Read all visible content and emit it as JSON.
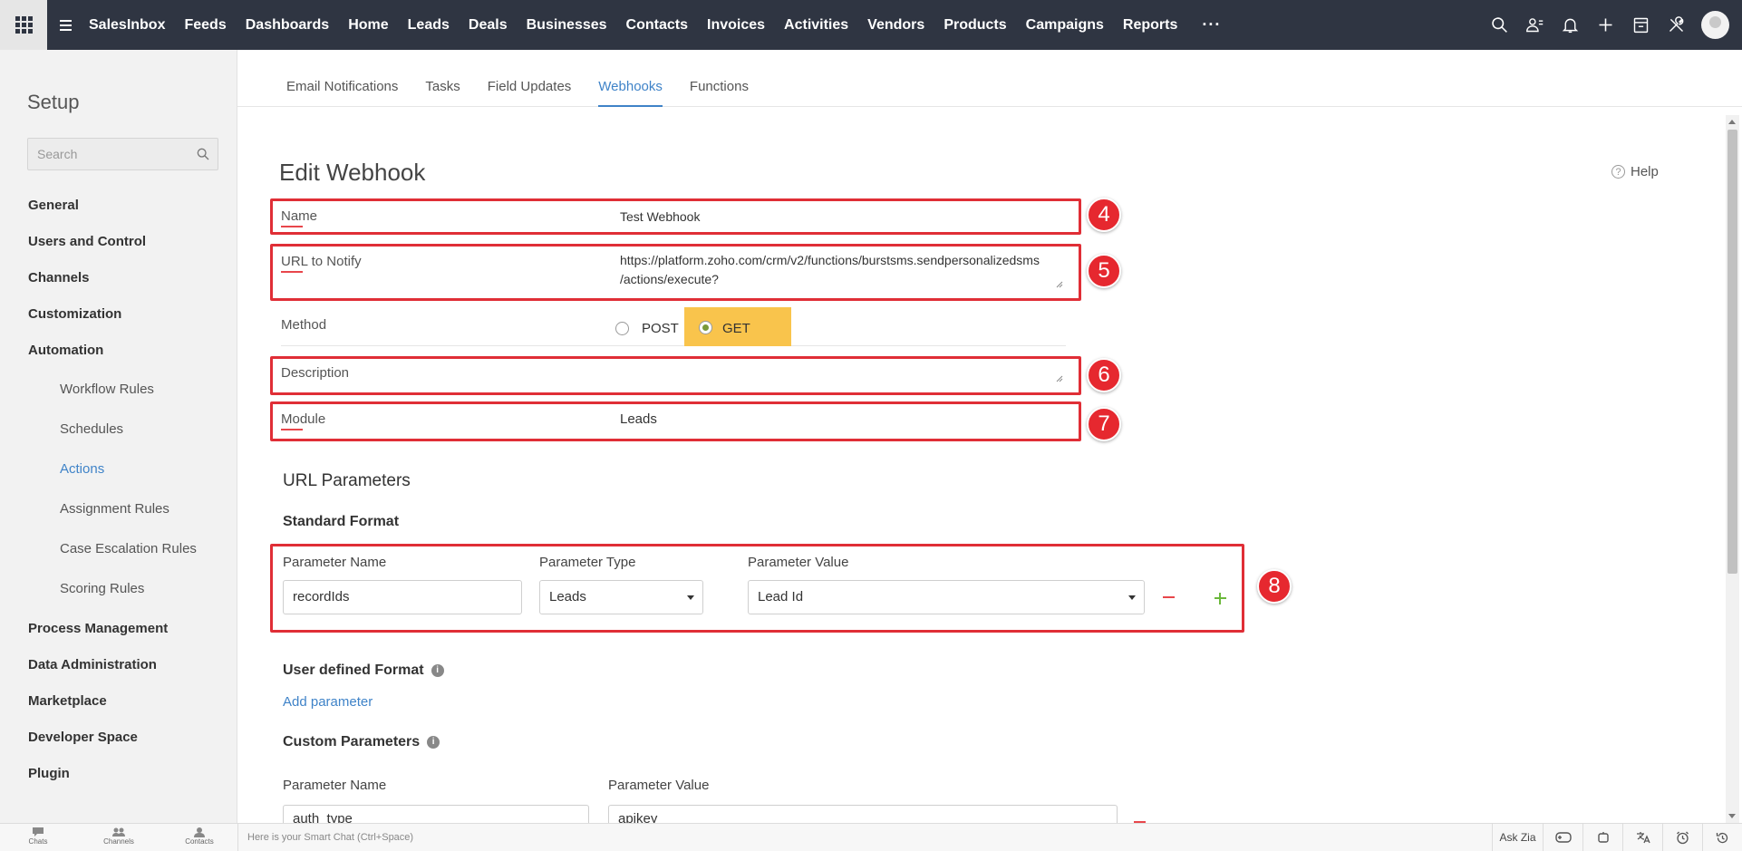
{
  "topbar": {
    "nav": [
      "SalesInbox",
      "Feeds",
      "Dashboards",
      "Home",
      "Leads",
      "Deals",
      "Businesses",
      "Contacts",
      "Invoices",
      "Activities",
      "Vendors",
      "Products",
      "Campaigns",
      "Reports"
    ],
    "more": "···",
    "icons": [
      "search-icon",
      "contacts-icon",
      "bell-icon",
      "plus-icon",
      "calendar-icon",
      "tools-icon"
    ]
  },
  "sidebar": {
    "title": "Setup",
    "search_placeholder": "Search",
    "items": [
      {
        "label": "General"
      },
      {
        "label": "Users and Control"
      },
      {
        "label": "Channels"
      },
      {
        "label": "Customization"
      },
      {
        "label": "Automation"
      },
      {
        "label": "Workflow Rules"
      },
      {
        "label": "Schedules"
      },
      {
        "label": "Actions"
      },
      {
        "label": "Assignment Rules"
      },
      {
        "label": "Case Escalation Rules"
      },
      {
        "label": "Scoring Rules"
      },
      {
        "label": "Process Management"
      },
      {
        "label": "Data Administration"
      },
      {
        "label": "Marketplace"
      },
      {
        "label": "Developer Space"
      },
      {
        "label": "Plugin"
      }
    ]
  },
  "tabs": [
    "Email Notifications",
    "Tasks",
    "Field Updates",
    "Webhooks",
    "Functions"
  ],
  "form": {
    "title": "Edit Webhook",
    "help": "Help",
    "name_label": "Name",
    "name_value": "Test Webhook",
    "url_label": "URL to Notify",
    "url_line1": "https://platform.zoho.com/crm/v2/functions/burstsms.sendpersonalizedsms",
    "url_line2": "/actions/execute?",
    "method_label": "Method",
    "method_post": "POST",
    "method_get": "GET",
    "description_label": "Description",
    "module_label": "Module",
    "module_value": "Leads",
    "badges": [
      "4",
      "5",
      "6",
      "7",
      "8"
    ]
  },
  "url_params": {
    "title": "URL Parameters",
    "standard_title": "Standard Format",
    "col_name": "Parameter Name",
    "col_type": "Parameter Type",
    "col_value": "Parameter Value",
    "row_name": "recordIds",
    "row_type": "Leads",
    "row_value": "Lead Id",
    "user_defined_title": "User defined Format",
    "add_parameter": "Add parameter",
    "custom_title": "Custom Parameters",
    "custom_col_name": "Parameter Name",
    "custom_col_value": "Parameter Value",
    "custom_row_name": "auth_type",
    "custom_row_value": "apikey"
  },
  "bottombar": {
    "items": [
      "Chats",
      "Channels",
      "Contacts"
    ],
    "smartchat": "Here is your Smart Chat (Ctrl+Space)",
    "ask_zia": "Ask Zia"
  }
}
